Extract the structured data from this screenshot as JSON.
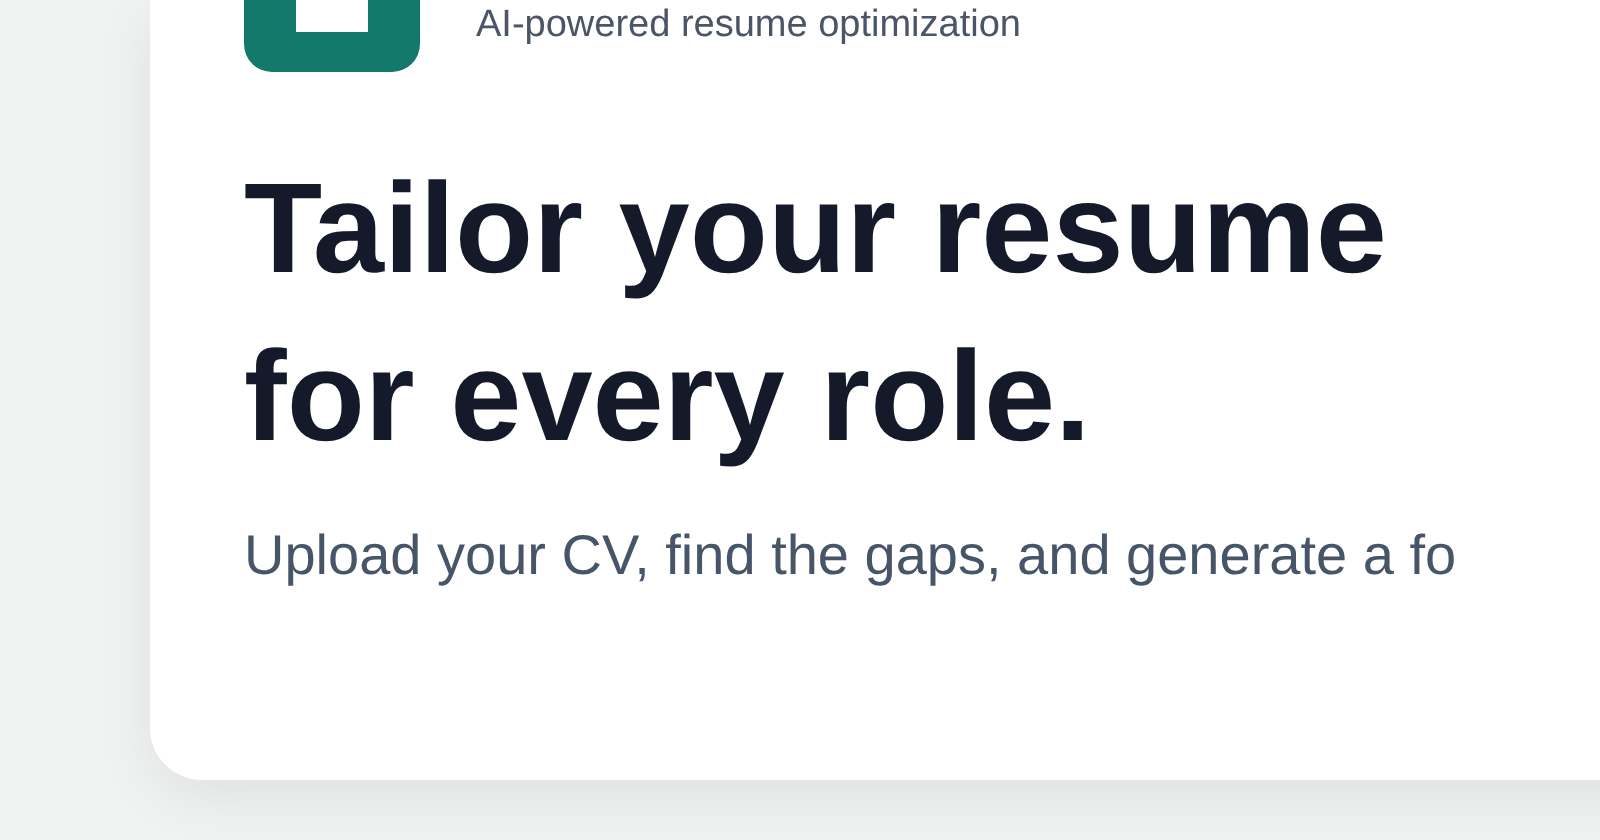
{
  "brand": {
    "tagline": "AI-powered resume optimization"
  },
  "hero": {
    "headline_lines": [
      "Tailor your resume",
      "for every role."
    ],
    "subtitle": "Upload your CV, find the gaps, and generate a fo"
  }
}
